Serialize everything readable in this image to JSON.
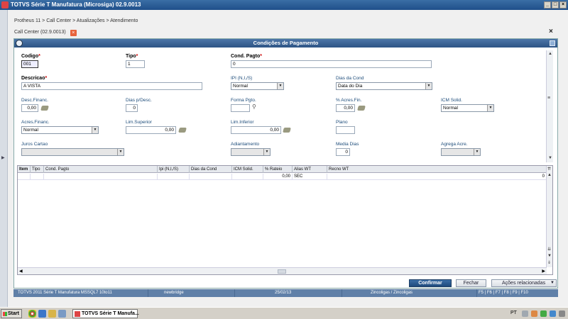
{
  "window": {
    "title": "TOTVS Série T Manufatura (Microsiga) 02.9.0013",
    "minimize": "_",
    "maximize": "□",
    "close": "×"
  },
  "breadcrumb": "Protheus 11 > Call Center > Atualizações > Atendimento",
  "tab": {
    "label": "Call Center (02.9.0013)",
    "close": "×"
  },
  "main_close": "×",
  "dialog": {
    "title": "Condições de Pagamento",
    "fields": {
      "codigo": {
        "label": "Codigo",
        "value": "001"
      },
      "tipo": {
        "label": "Tipo",
        "value": "1"
      },
      "cond_pagto": {
        "label": "Cond. Pagto",
        "value": "0"
      },
      "descricao": {
        "label": "Descricao",
        "value": "A VISTA"
      },
      "ipi": {
        "label": "IPI (N,I,/S)",
        "value": "Normal"
      },
      "dias_cond": {
        "label": "Dias da Cond",
        "value": "Data do Dia"
      },
      "desc_financ": {
        "label": "Desc.Financ.",
        "value": "0,00"
      },
      "dias_desc": {
        "label": "Dias p/Desc.",
        "value": "0"
      },
      "forma_pgto": {
        "label": "Forma Pgto.",
        "value": ""
      },
      "acres_fin": {
        "label": "% Acres.Fin.",
        "value": "0,00"
      },
      "icm_solid": {
        "label": "ICM Solid.",
        "value": "Normal"
      },
      "acres_financ": {
        "label": "Acres.Financ.",
        "value": "Normal"
      },
      "lim_superior": {
        "label": "Lim.Superior",
        "value": "0,00"
      },
      "lim_inferior": {
        "label": "Lim.Inferior",
        "value": "0,00"
      },
      "plano": {
        "label": "Plano",
        "value": ""
      },
      "juros_cartao": {
        "label": "Juros Cartao",
        "value": ""
      },
      "adiantamento": {
        "label": "Adiantamento",
        "value": ""
      },
      "media_dias": {
        "label": "Media Dias",
        "value": "0"
      },
      "agrega_acre": {
        "label": "Agrega Acre.",
        "value": ""
      }
    },
    "required_mark": "*",
    "grid": {
      "columns": [
        "Item",
        "Tipo",
        "Cond. Pagto",
        "Ipi (N,I,/S)",
        "Dias da Cond",
        "ICM Solid.",
        "% Rateio",
        "Alias WT",
        "Recno WT"
      ],
      "rows": [
        {
          "item": "",
          "tipo": "",
          "cond_pagto": "",
          "ipi": "",
          "dias_cond": "",
          "icm_solid": "",
          "rateio": "0,00",
          "alias": "SEC",
          "recno": "0"
        }
      ]
    },
    "buttons": {
      "confirmar": "Confirmar",
      "fechar": "Fechar",
      "acoes": "Ações relacionadas"
    }
  },
  "statusbar": {
    "product": "TOTVS 2011 Série T Manufatura MSSQL7 10to11",
    "user": "newbridge",
    "date": "25/02/13",
    "company": "Zincoligas / Zincoligas",
    "keys": "F5 | F6 | F7 | F8 | F9 | F10"
  },
  "taskbar": {
    "start": "Start",
    "task": "TOTVS Série T Manufa...",
    "lang": "PT"
  }
}
